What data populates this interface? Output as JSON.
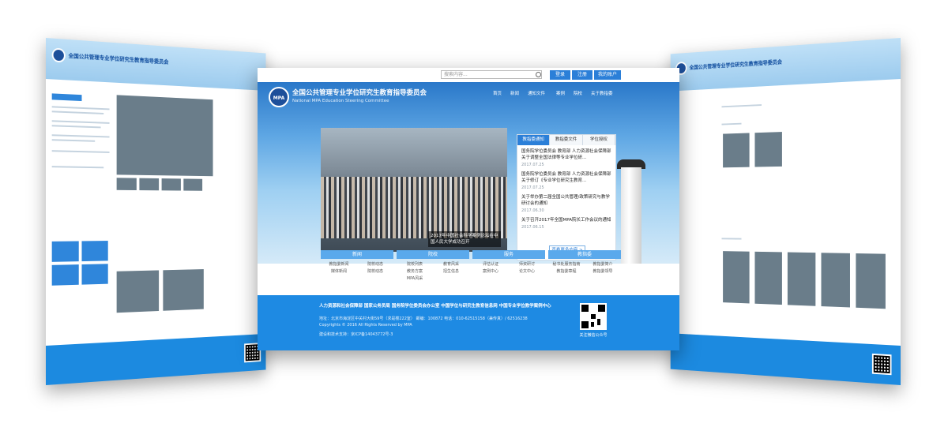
{
  "main_page": {
    "search": {
      "placeholder": "搜索内容..."
    },
    "top_buttons": [
      "登录",
      "注册",
      "我的账户"
    ],
    "site": {
      "title": "全国公共管理专业学位研究生教育指导委员会",
      "subtitle": "National MPA Education Steering Committee",
      "logo_text": "MPA"
    },
    "nav": [
      "首页",
      "新闻",
      "通知文件",
      "案例",
      "院校",
      "关于教指委"
    ],
    "photo_caption": "2017年中国社会科学案例论坛在中国人民大学成功召开",
    "panel": {
      "tabs": [
        "教指委通知",
        "教指委文件",
        "学位授权"
      ],
      "items": [
        {
          "text": "国务院学位委员会 教育部 人力资源社会保障部 关于调整全国法律等专业学位研...",
          "date": "2017.07.25"
        },
        {
          "text": "国务院学位委员会 教育部 人力资源社会保障部 关于修订《专业学位研究生教育...",
          "date": "2017.07.25"
        },
        {
          "text": "关于举办第二届全国公共管理/政策研究与教学研讨会的通知",
          "date": "2017.06.30"
        },
        {
          "text": "关于召开2017年全国MPA院长工作会议的通知",
          "date": "2017.06.15"
        }
      ],
      "more": "查看更多内容 >"
    },
    "categories": [
      {
        "title": "新闻",
        "links": [
          "教指委新闻",
          "院校动态",
          "媒体新闻",
          "院校动态"
        ]
      },
      {
        "title": "院校",
        "links": [
          "院校列表",
          "教育风采",
          "教务方案",
          "招生信息",
          "MPA风采",
          ""
        ]
      },
      {
        "title": "服务",
        "links": [
          "评估认证",
          "师资研讨",
          "案例中心",
          "论文中心"
        ]
      },
      {
        "title": "教指委",
        "links": [
          "秘书处服务指南",
          "教指委简介",
          "教指委章程",
          "教指委领导"
        ]
      }
    ],
    "footer": {
      "links": "人力资源和社会保障部   国家公务员局   国务院学位委员会办公室   中国学位与研究生教育信息网   中国专业学位教学案例中心",
      "address": "地址：北京市海淀区中关村大街59号（求是楼222室）  邮编：100872  电话：010-62515158（兼传真）/ 62516238",
      "copyright": "Copyrights © 2016 All Rights Reserved by MPA",
      "icp": "建设和技术支持：京ICP备14043772号-3",
      "qr_label": "关注微信公众号"
    }
  },
  "left_page": {
    "title": "全国公共管理专业学位研究生教育指导委员会"
  },
  "right_page": {
    "title": "全国公共管理专业学位研究生教育指导委员会"
  },
  "colors": {
    "primary": "#2b7fd8",
    "footer": "#1e8ae3",
    "hero_top": "#2a78c9"
  }
}
